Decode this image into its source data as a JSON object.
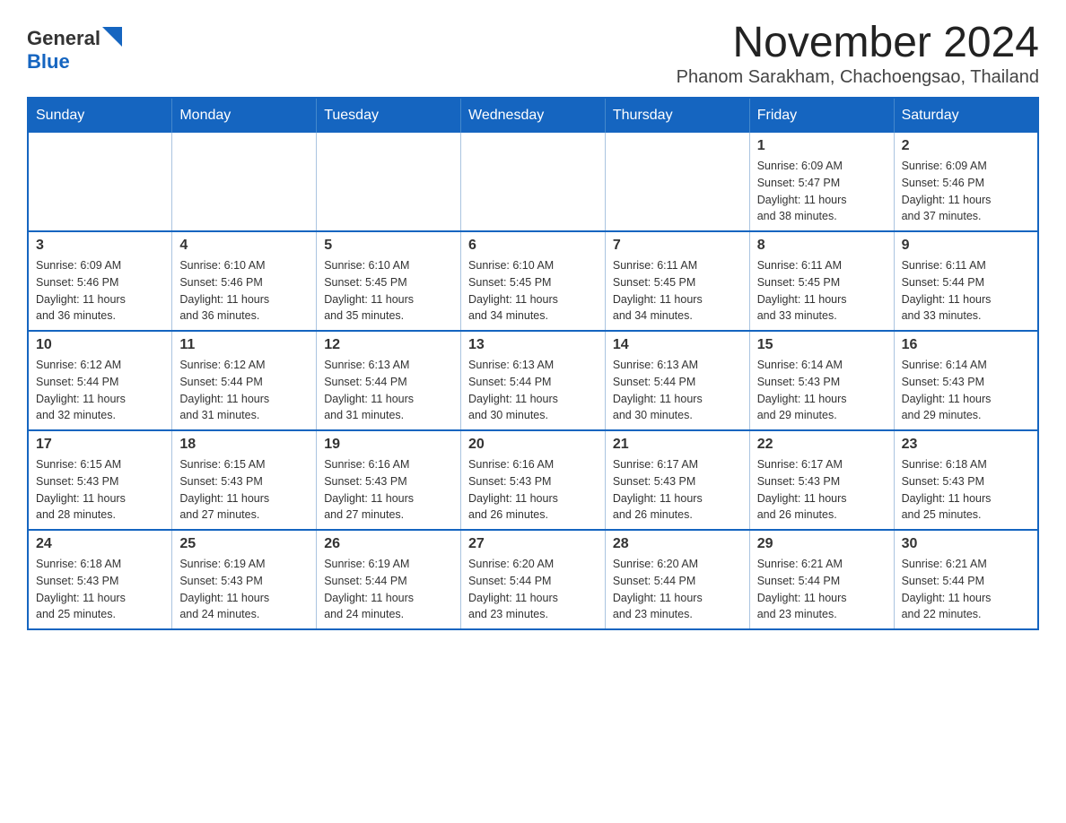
{
  "header": {
    "logo_general": "General",
    "logo_blue": "Blue",
    "title": "November 2024",
    "subtitle": "Phanom Sarakham, Chachoengsao, Thailand"
  },
  "calendar": {
    "days_of_week": [
      "Sunday",
      "Monday",
      "Tuesday",
      "Wednesday",
      "Thursday",
      "Friday",
      "Saturday"
    ],
    "weeks": [
      [
        {
          "day": "",
          "info": ""
        },
        {
          "day": "",
          "info": ""
        },
        {
          "day": "",
          "info": ""
        },
        {
          "day": "",
          "info": ""
        },
        {
          "day": "",
          "info": ""
        },
        {
          "day": "1",
          "info": "Sunrise: 6:09 AM\nSunset: 5:47 PM\nDaylight: 11 hours\nand 38 minutes."
        },
        {
          "day": "2",
          "info": "Sunrise: 6:09 AM\nSunset: 5:46 PM\nDaylight: 11 hours\nand 37 minutes."
        }
      ],
      [
        {
          "day": "3",
          "info": "Sunrise: 6:09 AM\nSunset: 5:46 PM\nDaylight: 11 hours\nand 36 minutes."
        },
        {
          "day": "4",
          "info": "Sunrise: 6:10 AM\nSunset: 5:46 PM\nDaylight: 11 hours\nand 36 minutes."
        },
        {
          "day": "5",
          "info": "Sunrise: 6:10 AM\nSunset: 5:45 PM\nDaylight: 11 hours\nand 35 minutes."
        },
        {
          "day": "6",
          "info": "Sunrise: 6:10 AM\nSunset: 5:45 PM\nDaylight: 11 hours\nand 34 minutes."
        },
        {
          "day": "7",
          "info": "Sunrise: 6:11 AM\nSunset: 5:45 PM\nDaylight: 11 hours\nand 34 minutes."
        },
        {
          "day": "8",
          "info": "Sunrise: 6:11 AM\nSunset: 5:45 PM\nDaylight: 11 hours\nand 33 minutes."
        },
        {
          "day": "9",
          "info": "Sunrise: 6:11 AM\nSunset: 5:44 PM\nDaylight: 11 hours\nand 33 minutes."
        }
      ],
      [
        {
          "day": "10",
          "info": "Sunrise: 6:12 AM\nSunset: 5:44 PM\nDaylight: 11 hours\nand 32 minutes."
        },
        {
          "day": "11",
          "info": "Sunrise: 6:12 AM\nSunset: 5:44 PM\nDaylight: 11 hours\nand 31 minutes."
        },
        {
          "day": "12",
          "info": "Sunrise: 6:13 AM\nSunset: 5:44 PM\nDaylight: 11 hours\nand 31 minutes."
        },
        {
          "day": "13",
          "info": "Sunrise: 6:13 AM\nSunset: 5:44 PM\nDaylight: 11 hours\nand 30 minutes."
        },
        {
          "day": "14",
          "info": "Sunrise: 6:13 AM\nSunset: 5:44 PM\nDaylight: 11 hours\nand 30 minutes."
        },
        {
          "day": "15",
          "info": "Sunrise: 6:14 AM\nSunset: 5:43 PM\nDaylight: 11 hours\nand 29 minutes."
        },
        {
          "day": "16",
          "info": "Sunrise: 6:14 AM\nSunset: 5:43 PM\nDaylight: 11 hours\nand 29 minutes."
        }
      ],
      [
        {
          "day": "17",
          "info": "Sunrise: 6:15 AM\nSunset: 5:43 PM\nDaylight: 11 hours\nand 28 minutes."
        },
        {
          "day": "18",
          "info": "Sunrise: 6:15 AM\nSunset: 5:43 PM\nDaylight: 11 hours\nand 27 minutes."
        },
        {
          "day": "19",
          "info": "Sunrise: 6:16 AM\nSunset: 5:43 PM\nDaylight: 11 hours\nand 27 minutes."
        },
        {
          "day": "20",
          "info": "Sunrise: 6:16 AM\nSunset: 5:43 PM\nDaylight: 11 hours\nand 26 minutes."
        },
        {
          "day": "21",
          "info": "Sunrise: 6:17 AM\nSunset: 5:43 PM\nDaylight: 11 hours\nand 26 minutes."
        },
        {
          "day": "22",
          "info": "Sunrise: 6:17 AM\nSunset: 5:43 PM\nDaylight: 11 hours\nand 26 minutes."
        },
        {
          "day": "23",
          "info": "Sunrise: 6:18 AM\nSunset: 5:43 PM\nDaylight: 11 hours\nand 25 minutes."
        }
      ],
      [
        {
          "day": "24",
          "info": "Sunrise: 6:18 AM\nSunset: 5:43 PM\nDaylight: 11 hours\nand 25 minutes."
        },
        {
          "day": "25",
          "info": "Sunrise: 6:19 AM\nSunset: 5:43 PM\nDaylight: 11 hours\nand 24 minutes."
        },
        {
          "day": "26",
          "info": "Sunrise: 6:19 AM\nSunset: 5:44 PM\nDaylight: 11 hours\nand 24 minutes."
        },
        {
          "day": "27",
          "info": "Sunrise: 6:20 AM\nSunset: 5:44 PM\nDaylight: 11 hours\nand 23 minutes."
        },
        {
          "day": "28",
          "info": "Sunrise: 6:20 AM\nSunset: 5:44 PM\nDaylight: 11 hours\nand 23 minutes."
        },
        {
          "day": "29",
          "info": "Sunrise: 6:21 AM\nSunset: 5:44 PM\nDaylight: 11 hours\nand 23 minutes."
        },
        {
          "day": "30",
          "info": "Sunrise: 6:21 AM\nSunset: 5:44 PM\nDaylight: 11 hours\nand 22 minutes."
        }
      ]
    ]
  }
}
